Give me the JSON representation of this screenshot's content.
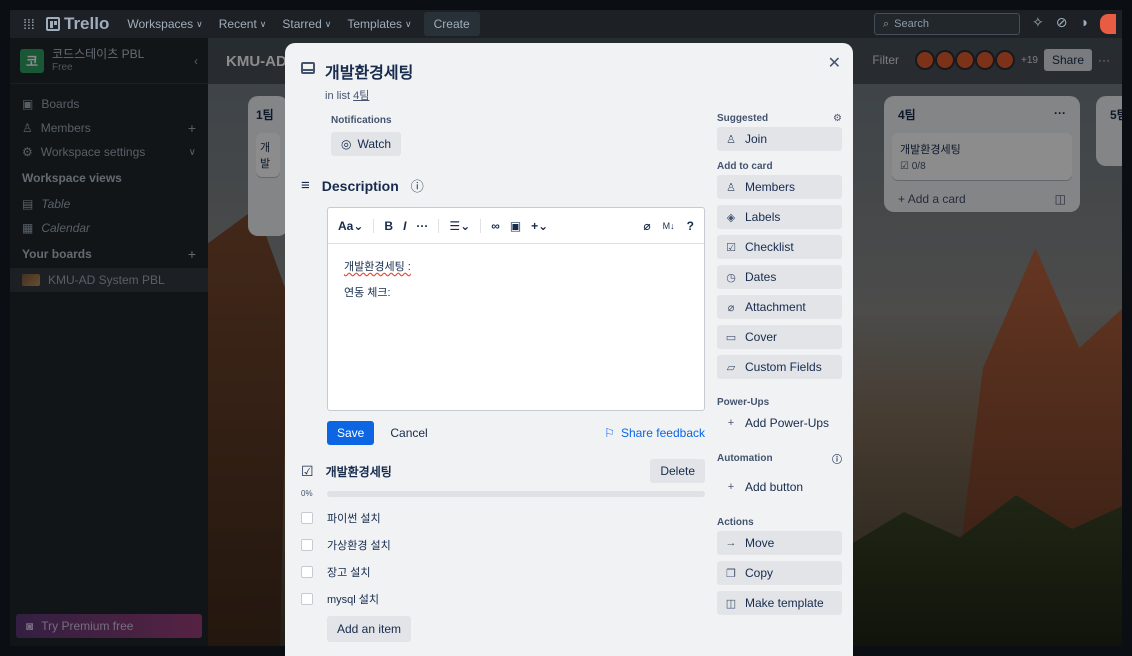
{
  "topnav": {
    "logo": "Trello",
    "items": [
      "Workspaces",
      "Recent",
      "Starred",
      "Templates"
    ],
    "create": "Create",
    "search_placeholder": "Search"
  },
  "sidebar": {
    "workspace_badge": "코",
    "workspace_name": "코드스테이츠 PBL",
    "plan": "Free",
    "items": [
      {
        "label": "Boards"
      },
      {
        "label": "Members"
      },
      {
        "label": "Workspace settings"
      }
    ],
    "views_header": "Workspace views",
    "views": [
      "Table",
      "Calendar"
    ],
    "boards_header": "Your boards",
    "boards": [
      "KMU-AD System PBL"
    ],
    "premium": "Try Premium free"
  },
  "board": {
    "title": "KMU-AD",
    "filter": "Filter",
    "more_members": "+19",
    "share": "Share",
    "list1_title": "1팀",
    "list1_card": "개발",
    "list4_title": "4팀",
    "list4_card": "개발환경세팅",
    "list4_card_badge": "0/8",
    "add_card": "Add a card",
    "list5_title": "5팀"
  },
  "modal": {
    "title": "개발환경세팅",
    "in_list_prefix": "in list",
    "list_name": "4팀",
    "notifications_label": "Notifications",
    "watch": "Watch",
    "description_title": "Description",
    "toolbar": {
      "text_style": "Aa",
      "bold": "B",
      "italic": "I",
      "more": "···",
      "list": "☰",
      "plus": "+",
      "markdown": "M↓",
      "help": "?"
    },
    "description_lines": [
      "개발환경세팅 :",
      "연동 체크:"
    ],
    "save": "Save",
    "cancel": "Cancel",
    "share_feedback": "Share feedback",
    "checklist": {
      "title": "개발환경세팅",
      "delete": "Delete",
      "percent": "0%",
      "progress": 0,
      "items": [
        "파이썬 설치",
        "가상환경 설치",
        "장고 설치",
        "mysql 설치"
      ],
      "add_item": "Add an item"
    },
    "suggested": {
      "header": "Suggested",
      "join": "Join"
    },
    "add_to_card": {
      "header": "Add to card",
      "buttons": [
        "Members",
        "Labels",
        "Checklist",
        "Dates",
        "Attachment",
        "Cover",
        "Custom Fields"
      ]
    },
    "power_ups": {
      "header": "Power-Ups",
      "add": "Add Power-Ups"
    },
    "automation": {
      "header": "Automation",
      "add_button": "Add button"
    },
    "actions": {
      "header": "Actions",
      "buttons": [
        "Move",
        "Copy",
        "Make template"
      ]
    }
  },
  "colors": {
    "primary": "#0c66e4",
    "nav_bg": "#1d2125",
    "sidebar_bg": "#22272b",
    "modal_bg": "#f1f2f4",
    "progress": "#22a06b"
  }
}
